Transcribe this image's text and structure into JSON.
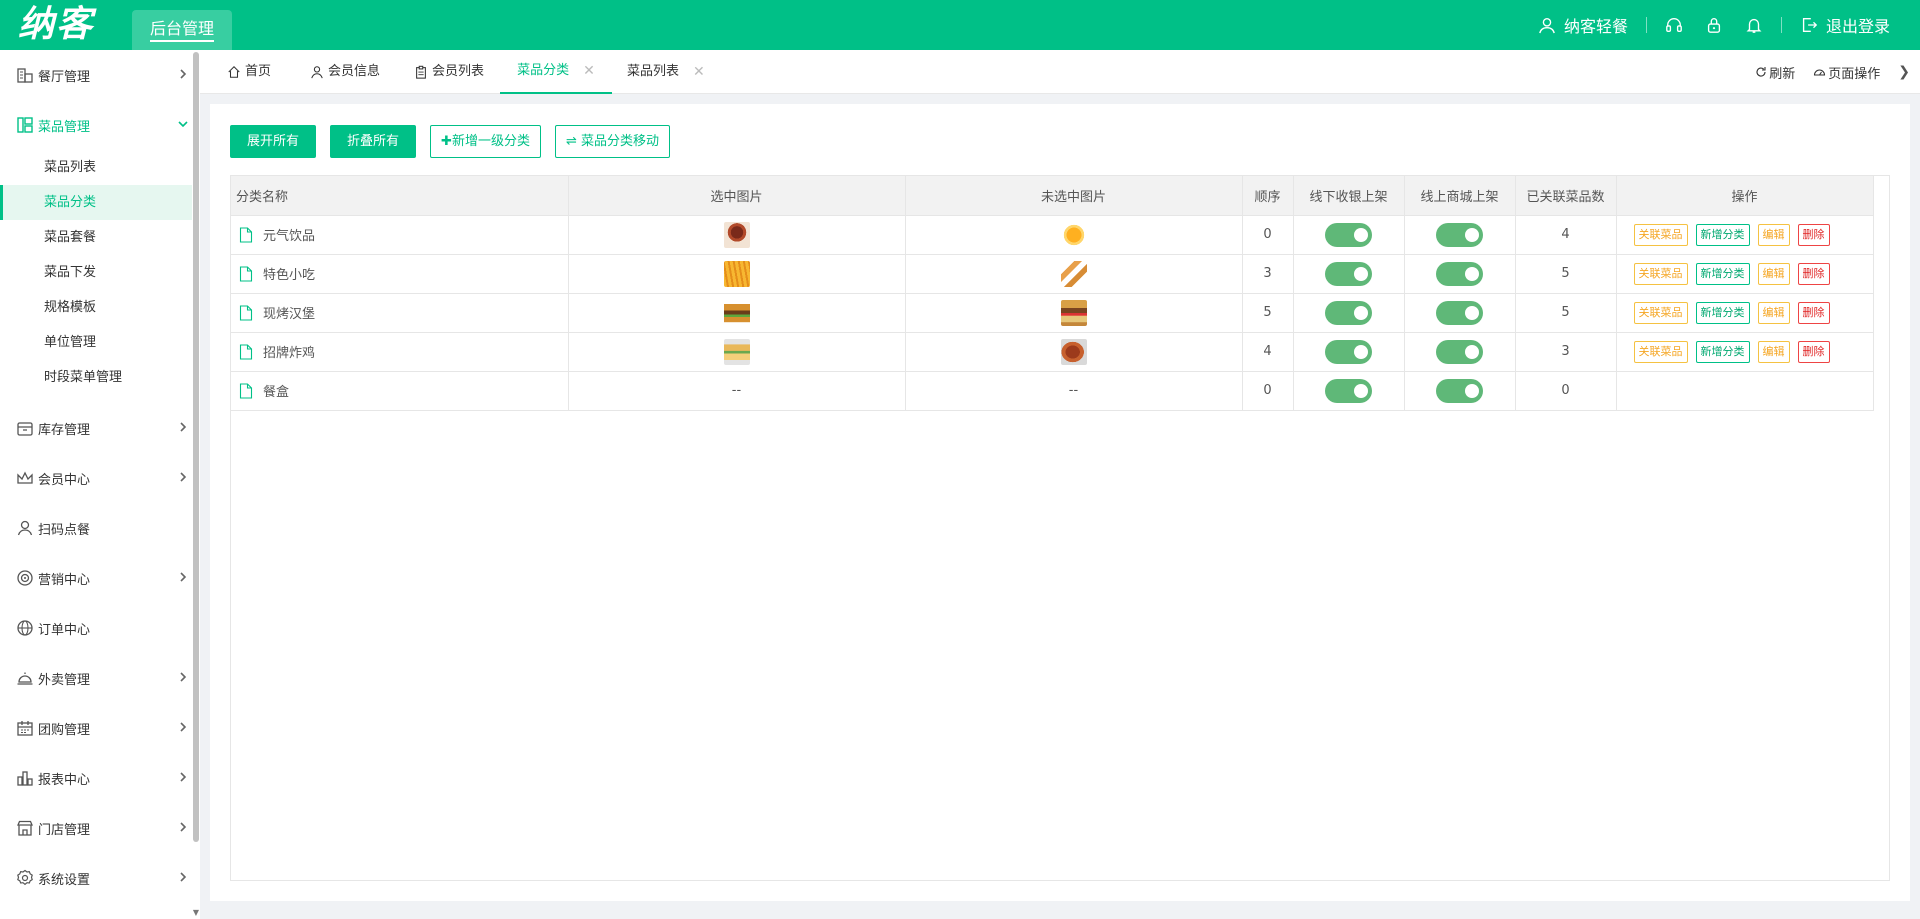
{
  "header": {
    "logo": "纳客",
    "admin_tab": "后台管理",
    "user": "纳客轻餐",
    "logout": "退出登录"
  },
  "sidebar": {
    "items": [
      {
        "label": "餐厅管理",
        "icon": "building-icon",
        "expandable": true
      },
      {
        "label": "菜品管理",
        "icon": "layout-icon",
        "expandable": true,
        "open": true
      },
      {
        "label": "库存管理",
        "icon": "box-icon",
        "expandable": true
      },
      {
        "label": "会员中心",
        "icon": "crown-icon",
        "expandable": true
      },
      {
        "label": "扫码点餐",
        "icon": "user-icon",
        "expandable": false
      },
      {
        "label": "营销中心",
        "icon": "target-icon",
        "expandable": true
      },
      {
        "label": "订单中心",
        "icon": "globe-icon",
        "expandable": false
      },
      {
        "label": "外卖管理",
        "icon": "cloche-icon",
        "expandable": true
      },
      {
        "label": "团购管理",
        "icon": "calendar-icon",
        "expandable": true
      },
      {
        "label": "报表中心",
        "icon": "bar-chart-icon",
        "expandable": true
      },
      {
        "label": "门店管理",
        "icon": "store-icon",
        "expandable": true
      },
      {
        "label": "系统设置",
        "icon": "gear-icon",
        "expandable": true
      }
    ],
    "subitems": [
      "菜品列表",
      "菜品分类",
      "菜品套餐",
      "菜品下发",
      "规格模板",
      "单位管理",
      "时段菜单管理"
    ],
    "active_sub": "菜品分类"
  },
  "tabs": [
    {
      "label": "首页",
      "icon": "home-icon",
      "closable": false,
      "active": false
    },
    {
      "label": "会员信息",
      "icon": "user-icon",
      "closable": false,
      "active": false
    },
    {
      "label": "会员列表",
      "icon": "clipboard-icon",
      "closable": false,
      "active": false
    },
    {
      "label": "菜品分类",
      "icon": "",
      "closable": true,
      "active": true
    },
    {
      "label": "菜品列表",
      "icon": "",
      "closable": true,
      "active": false
    }
  ],
  "tabs_right": {
    "refresh": "刷新",
    "page_ops": "页面操作"
  },
  "buttons": {
    "expand_all": "展开所有",
    "collapse_all": "折叠所有",
    "add_top": "新增一级分类",
    "move": "菜品分类移动"
  },
  "table": {
    "columns": [
      "分类名称",
      "选中图片",
      "未选中图片",
      "顺序",
      "线下收银上架",
      "线上商城上架",
      "已关联菜品数",
      "操作"
    ],
    "rows": [
      {
        "name": "元气饮品",
        "img_sel": "drink",
        "img_unsel": "juice",
        "order": "0",
        "offline": true,
        "online": true,
        "count": "4",
        "has_ops": true
      },
      {
        "name": "特色小吃",
        "img_sel": "fries",
        "img_unsel": "snack",
        "order": "3",
        "offline": true,
        "online": true,
        "count": "5",
        "has_ops": true
      },
      {
        "name": "现烤汉堡",
        "img_sel": "burger",
        "img_unsel": "burger2",
        "order": "5",
        "offline": true,
        "online": true,
        "count": "5",
        "has_ops": true
      },
      {
        "name": "招牌炸鸡",
        "img_sel": "sandwich",
        "img_unsel": "wings",
        "order": "4",
        "offline": true,
        "online": true,
        "count": "3",
        "has_ops": true
      },
      {
        "name": "餐盒",
        "img_sel": "--",
        "img_unsel": "--",
        "order": "0",
        "offline": true,
        "online": true,
        "count": "0",
        "has_ops": false
      }
    ],
    "ops": {
      "link": "关联菜品",
      "add": "新增分类",
      "edit": "编辑",
      "delete": "删除"
    }
  },
  "colors": {
    "brand": "#00c087",
    "toggle": "#5fb878",
    "warn": "#f5a623",
    "danger": "#e02424"
  }
}
